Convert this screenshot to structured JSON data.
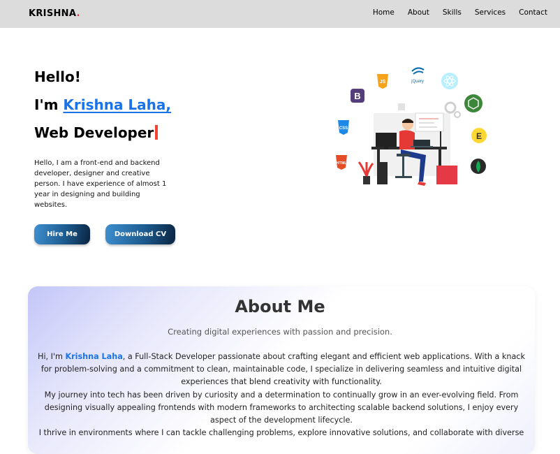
{
  "nav": {
    "logo": "KRISHNA",
    "logo_dot": ".",
    "links": [
      "Home",
      "About",
      "Skills",
      "Services",
      "Contact"
    ]
  },
  "hero": {
    "hello": "Hello!",
    "im_prefix": "I'm ",
    "name": "Krishna Laha,",
    "role": "Web Developer",
    "description": "Hello, I am a front-end and backend developer, designer and creative person. I have experience of almost 1 year in designing and building websites.",
    "hire_label": "Hire Me",
    "cv_label": "Download CV"
  },
  "illustration": {
    "icons": [
      "js-icon",
      "jquery-icon",
      "react-icon",
      "bootstrap-icon",
      "nodejs-icon",
      "css3-icon",
      "e-icon",
      "html5-icon",
      "mongodb-icon"
    ],
    "badges": {
      "js": "JS",
      "jquery": "jQuery",
      "bootstrap": "B",
      "css": "CSS",
      "e": "E",
      "html": "HTML"
    },
    "colors": {
      "js": "#f7a21b",
      "react": "#61dafb",
      "bootstrap": "#563d7c",
      "node": "#3c873a",
      "css": "#1e88e5",
      "e": "#fdd835",
      "html": "#e44d26",
      "mongo": "#13aa52"
    }
  },
  "about": {
    "title": "About Me",
    "subtitle": "Creating digital experiences with passion and precision.",
    "p1_prefix": "Hi, I'm ",
    "p1_name": "Krishna Laha",
    "p1_rest": ", a Full-Stack Developer passionate about crafting elegant and efficient web applications. With a knack for problem-solving and a commitment to clean, maintainable code, I specialize in delivering seamless and intuitive digital experiences that blend creativity with functionality.",
    "p2": "My journey into tech has been driven by curiosity and a determination to continually grow in an ever-evolving field. From designing visually appealing frontends with modern frameworks to architecting scalable backend solutions, I enjoy every aspect of the development lifecycle.",
    "p3": "I thrive in environments where I can tackle challenging problems, explore innovative solutions, and collaborate with diverse"
  }
}
